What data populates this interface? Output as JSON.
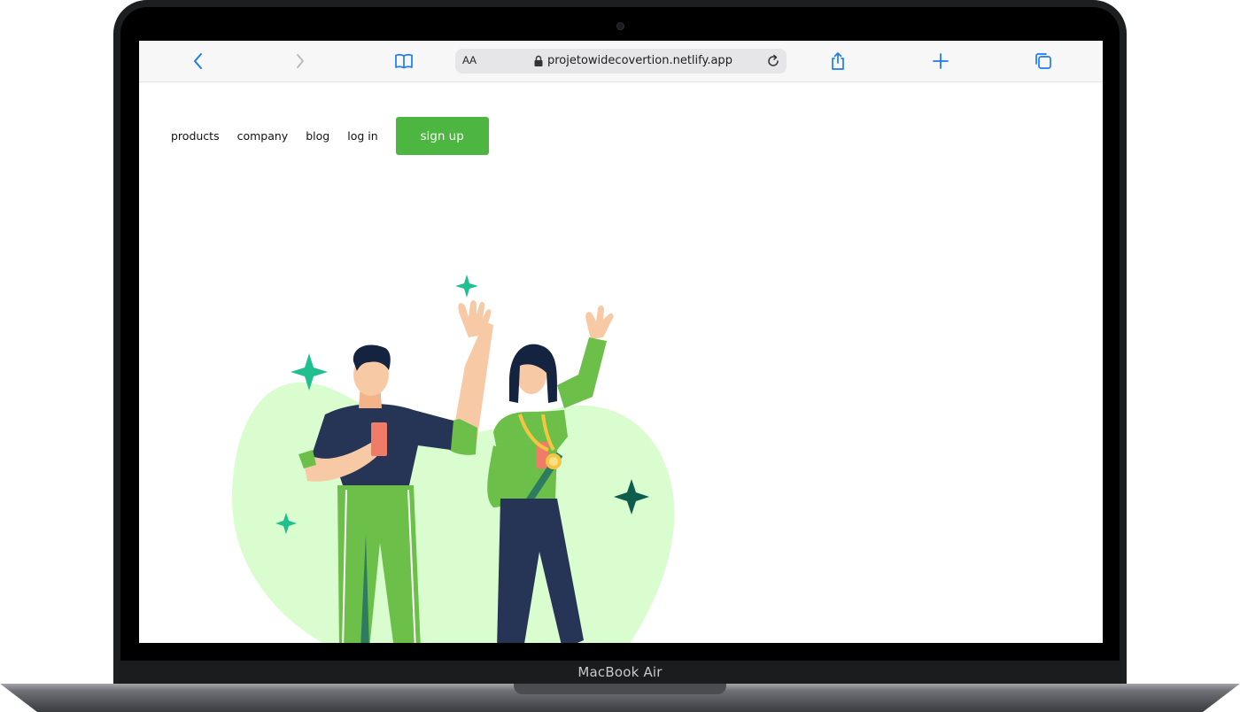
{
  "device": {
    "label": "MacBook Air"
  },
  "browser": {
    "text_size_label": "AA",
    "url": "projetowidecovertion.netlify.app",
    "icons": [
      "back-icon",
      "forward-icon",
      "bookmarks-icon",
      "lock-icon",
      "reload-icon",
      "share-icon",
      "new-tab-icon",
      "tabs-icon"
    ]
  },
  "nav": {
    "links": [
      "products",
      "company",
      "blog",
      "log in"
    ],
    "signup_label": "sign up"
  },
  "colors": {
    "accent_green": "#4db640",
    "blob_green": "#dafdd0",
    "safari_blue": "#1a7cf2",
    "sparkle_teal": "#1fbf8f",
    "navy": "#263455"
  }
}
